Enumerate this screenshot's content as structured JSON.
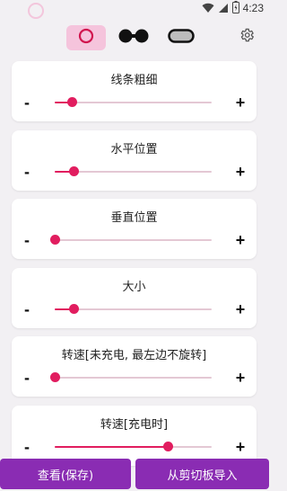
{
  "status_bar": {
    "time": "4:23",
    "icons": [
      "wifi-icon",
      "signal-icon",
      "battery-charging-icon"
    ]
  },
  "mode_tabs": [
    {
      "name": "ring-mode",
      "icon": "ring-icon",
      "active": true
    },
    {
      "name": "dual-dot-mode",
      "icon": "dual-dot-icon",
      "active": false
    },
    {
      "name": "pill-mode",
      "icon": "pill-icon",
      "active": false
    }
  ],
  "settings_icon": "gear-icon",
  "accent_color": "#e11d5f",
  "button_color": "#8a2cb3",
  "tab_active_color": "#f5c4dc",
  "sliders": [
    {
      "id": "line-thickness",
      "title": "线条粗细",
      "minus": "-",
      "plus": "+",
      "value_fraction": 0.11
    },
    {
      "id": "horizontal-position",
      "title": "水平位置",
      "minus": "-",
      "plus": "+",
      "value_fraction": 0.12
    },
    {
      "id": "vertical-position",
      "title": "垂直位置",
      "minus": "-",
      "plus": "+",
      "value_fraction": 0.0
    },
    {
      "id": "size",
      "title": "大小",
      "minus": "-",
      "plus": "+",
      "value_fraction": 0.12
    },
    {
      "id": "speed-not-charging",
      "title": "转速[未充电, 最左边不旋转]",
      "minus": "-",
      "plus": "+",
      "value_fraction": 0.0
    },
    {
      "id": "speed-charging",
      "title": "转速[充电时]",
      "minus": "-",
      "plus": "+",
      "value_fraction": 0.72
    }
  ],
  "bottom_buttons": {
    "view_save": "查看(保存)",
    "import_clipboard": "从剪切板导入"
  }
}
